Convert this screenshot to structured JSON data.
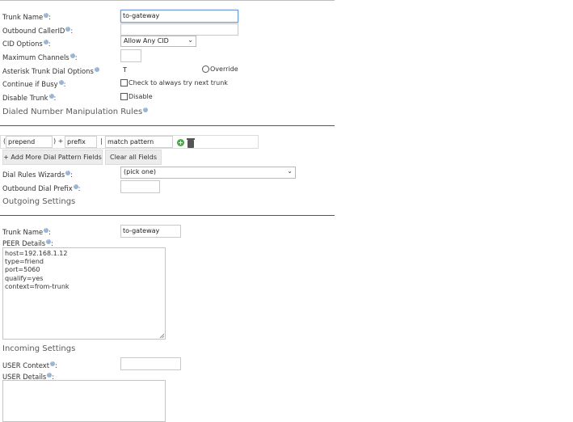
{
  "general": {
    "trunk_name_label": "Trunk Name",
    "trunk_name_value": "to-gateway",
    "outbound_callerid_label": "Outbound CallerID",
    "outbound_callerid_value": "",
    "cid_options_label": "CID Options",
    "cid_options_value": "Allow Any CID",
    "max_channels_label": "Maximum Channels",
    "max_channels_value": "",
    "dial_options_label": "Asterisk Trunk Dial Options",
    "dial_options_value": "T",
    "override_label": "Override",
    "continue_busy_label": "Continue if Busy",
    "continue_busy_check": "Check to always try next trunk",
    "disable_trunk_label": "Disable Trunk",
    "disable_check": "Disable",
    "colon": ":"
  },
  "dial_rules": {
    "section_title": "Dialed Number Manipulation Rules",
    "open_paren": "(",
    "prepend_placeholder": "prepend",
    "close_plus": ") +",
    "prefix_placeholder": "prefix",
    "pipe": "|",
    "match_placeholder": "match pattern",
    "add_more_button": "+ Add More Dial Pattern Fields",
    "clear_all_button": "Clear all Fields",
    "wizards_label": "Dial Rules Wizards",
    "wizards_value": "(pick one)",
    "outbound_prefix_label": "Outbound Dial Prefix",
    "outbound_prefix_value": ""
  },
  "outgoing": {
    "section_title": "Outgoing Settings",
    "trunk_name_label": "Trunk Name",
    "trunk_name_value": "to-gateway",
    "peer_details_label": "PEER Details",
    "peer_details_value": "host=192.168.1.12\ntype=friend\nport=5060\nqualify=yes\ncontext=from-trunk"
  },
  "incoming": {
    "section_title": "Incoming Settings",
    "user_context_label": "USER Context",
    "user_context_value": "",
    "user_details_label": "USER Details",
    "user_details_value": ""
  },
  "icons": {
    "help": "help-icon",
    "add": "plus-circle-icon",
    "delete": "trash-icon",
    "dropdown": "chevron-down-icon"
  },
  "colors": {
    "focus_border": "#6a9ad6",
    "help_icon": "#9ab4d4",
    "button_bg": "#ececec"
  }
}
